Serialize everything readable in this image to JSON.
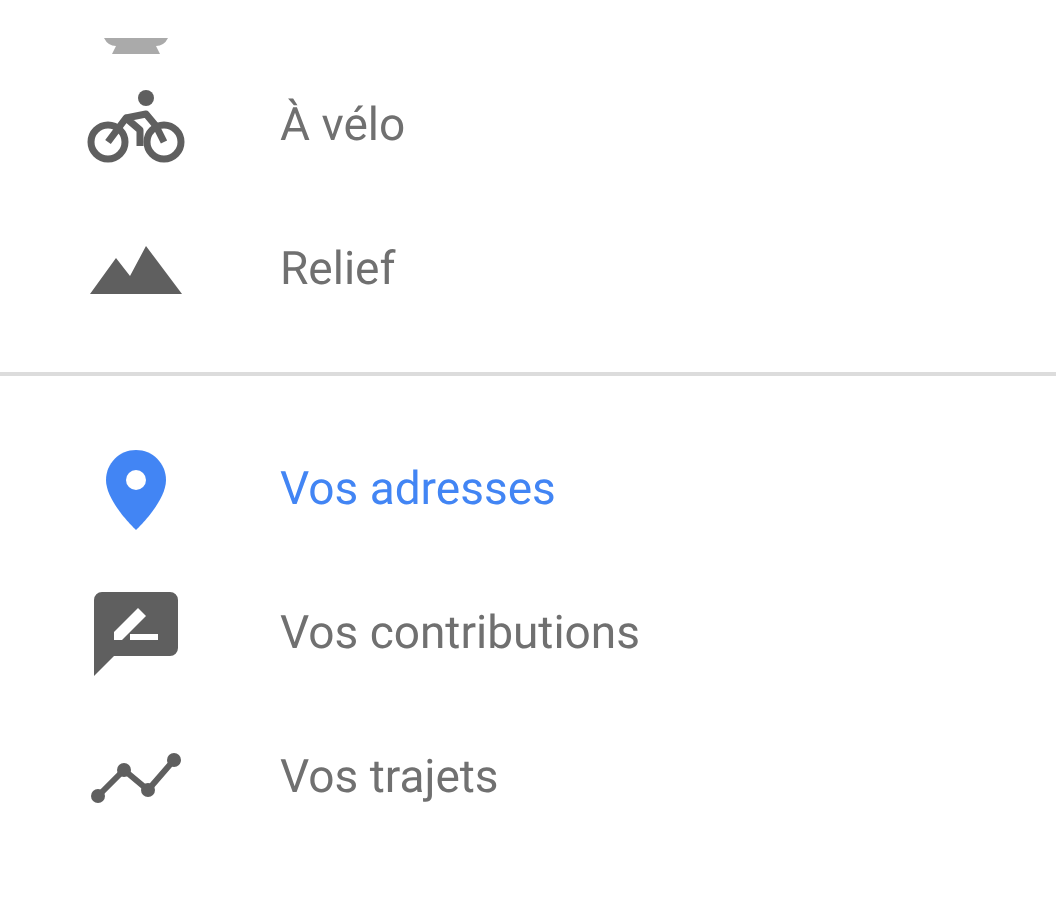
{
  "sections": [
    {
      "items": [
        {
          "kind": "bike",
          "label": "À vélo",
          "selected": false
        },
        {
          "kind": "terrain",
          "label": "Relief",
          "selected": false
        }
      ]
    },
    {
      "items": [
        {
          "kind": "pin",
          "label": "Vos adresses",
          "selected": true
        },
        {
          "kind": "contrib",
          "label": "Vos contributions",
          "selected": false
        },
        {
          "kind": "timeline",
          "label": "Vos trajets",
          "selected": false
        }
      ]
    }
  ]
}
